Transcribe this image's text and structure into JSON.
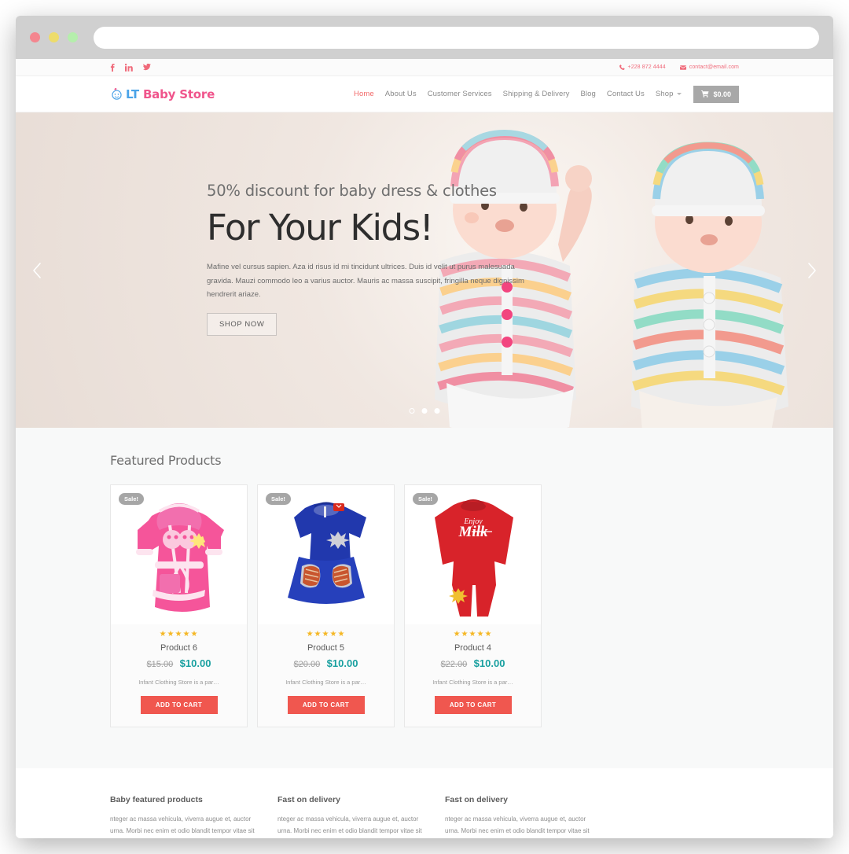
{
  "browser": {
    "url_value": "",
    "url_placeholder": "",
    "traffic_lights": [
      "close",
      "minimize",
      "maximize"
    ]
  },
  "topbar": {
    "social": [
      {
        "name": "facebook",
        "glyph": "f"
      },
      {
        "name": "linkedin",
        "glyph": "in"
      },
      {
        "name": "twitter",
        "glyph": "t"
      }
    ],
    "phone": "+228 872 4444",
    "email": "contact@email.com"
  },
  "header": {
    "logo_lt": "LT",
    "logo_rest": " Baby Store",
    "logo_icon": "baby-face-icon",
    "nav": [
      {
        "label": "Home",
        "active": true,
        "caret": false
      },
      {
        "label": "About Us",
        "active": false,
        "caret": false
      },
      {
        "label": "Customer Services",
        "active": false,
        "caret": false
      },
      {
        "label": "Shipping & Delivery",
        "active": false,
        "caret": false
      },
      {
        "label": "Blog",
        "active": false,
        "caret": false
      },
      {
        "label": "Contact Us",
        "active": false,
        "caret": false
      },
      {
        "label": "Shop",
        "active": false,
        "caret": true
      }
    ],
    "cart_total": "$0.00",
    "cart_icon": "shopping-cart-icon"
  },
  "hero": {
    "subtitle": "50% discount for baby dress & clothes",
    "title": "For Your Kids!",
    "description": "Mafine vel cursus sapien. Aza id risus id mi tincidunt ultrices. Duis id velit ut purus malesuada gravida. Mauzi commodo leo a varius auctor. Mauris ac massa suscipit, fringilla neque dignissim hendrerit ariaze.",
    "cta_label": "SHOP NOW",
    "prev_icon": "chevron-left-icon",
    "next_icon": "chevron-right-icon",
    "dots": 3,
    "active_dot": 0
  },
  "featured": {
    "title": "Featured Products",
    "products": [
      {
        "badge": "Sale!",
        "image": "pink-hooded-baby-robe",
        "rating": 5,
        "stars": "★★★★★",
        "name": "Product 6",
        "price_old": "$15.00",
        "price_new": "$10.00",
        "description": "Infant Clothing Store is a par…",
        "button_label": "ADD TO CART"
      },
      {
        "badge": "Sale!",
        "image": "blue-baby-dress",
        "rating": 5,
        "stars": "★★★★★",
        "name": "Product 5",
        "price_old": "$20.00",
        "price_new": "$10.00",
        "description": "Infant Clothing Store is a par…",
        "button_label": "ADD TO CART"
      },
      {
        "badge": "Sale!",
        "image": "red-enjoy-milk-romper",
        "rating": 5,
        "stars": "★★★★★",
        "name": "Product 4",
        "price_old": "$22.00",
        "price_new": "$10.00",
        "description": "Infant Clothing Store is a par…",
        "button_label": "ADD TO CART"
      }
    ]
  },
  "footer": {
    "columns": [
      {
        "title": "Baby featured products",
        "text": "nteger ac massa vehicula, viverra augue et, auctor urna. Morbi nec enim et odio blandit tempor vitae sit amet est."
      },
      {
        "title": "Fast on delivery",
        "text": "nteger ac massa vehicula, viverra augue et, auctor urna. Morbi nec enim et odio blandit tempor vitae sit amet est."
      },
      {
        "title": "Fast on delivery",
        "text": "nteger ac massa vehicula, viverra augue et, auctor urna. Morbi nec enim et odio blandit tempor vitae sit amet est."
      }
    ]
  },
  "colors": {
    "accent_pink": "#f0558c",
    "accent_blue": "#4aa3e8",
    "nav_active": "#f26a6a",
    "price_new": "#19a0a0",
    "cart_button": "#f0574f",
    "star": "#f5b724"
  }
}
